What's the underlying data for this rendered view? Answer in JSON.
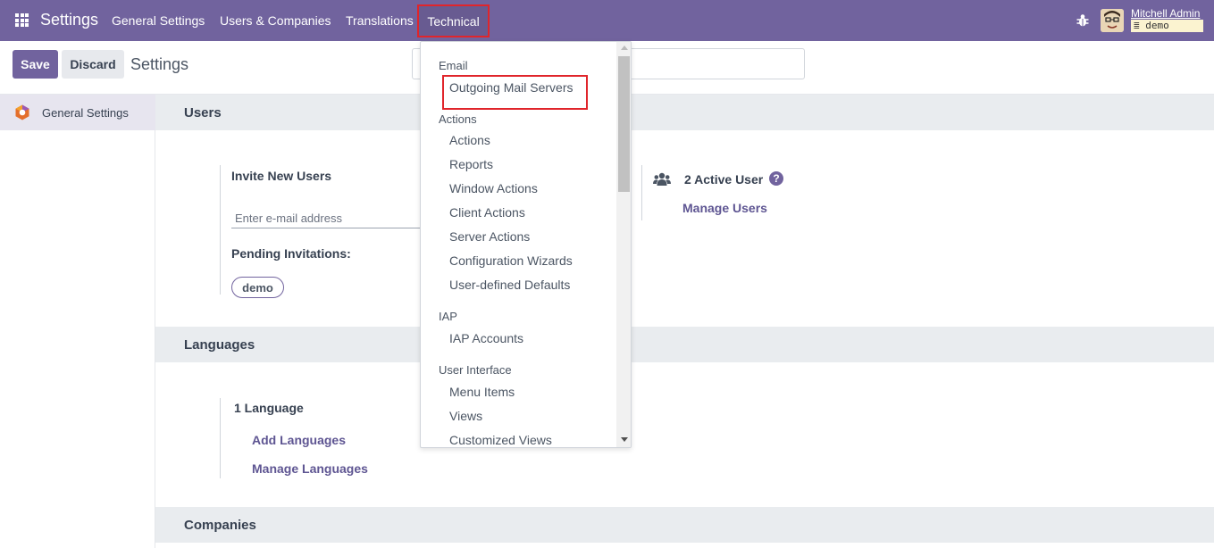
{
  "navbar": {
    "brand": "Settings",
    "menus": [
      "General Settings",
      "Users & Companies",
      "Translations",
      "Technical"
    ],
    "user_name": "Mitchell Admin",
    "database": "demo",
    "bg_color": "#71639e"
  },
  "control": {
    "save_label": "Save",
    "discard_label": "Discard",
    "title": "Settings"
  },
  "sidebar": {
    "items": [
      {
        "label": "General Settings",
        "icon": "odoo-settings-logo-icon"
      }
    ]
  },
  "sections": {
    "users": {
      "title": "Users",
      "invite_label": "Invite New Users",
      "email_placeholder": "Enter e-mail address",
      "pending_label": "Pending Invitations:",
      "pending": [
        "demo"
      ],
      "active_users": "2 Active User",
      "manage_users": "Manage Users"
    },
    "languages": {
      "title": "Languages",
      "count": "1 Language",
      "add": "Add Languages",
      "manage": "Manage Languages"
    },
    "companies": {
      "title": "Companies"
    }
  },
  "technical_menu": {
    "groups": [
      {
        "label": "Email",
        "items": [
          "Outgoing Mail Servers"
        ]
      },
      {
        "label": "Actions",
        "items": [
          "Actions",
          "Reports",
          "Window Actions",
          "Client Actions",
          "Server Actions",
          "Configuration Wizards",
          "User-defined Defaults"
        ]
      },
      {
        "label": "IAP",
        "items": [
          "IAP Accounts"
        ]
      },
      {
        "label": "User Interface",
        "items": [
          "Menu Items",
          "Views",
          "Customized Views"
        ]
      }
    ]
  }
}
